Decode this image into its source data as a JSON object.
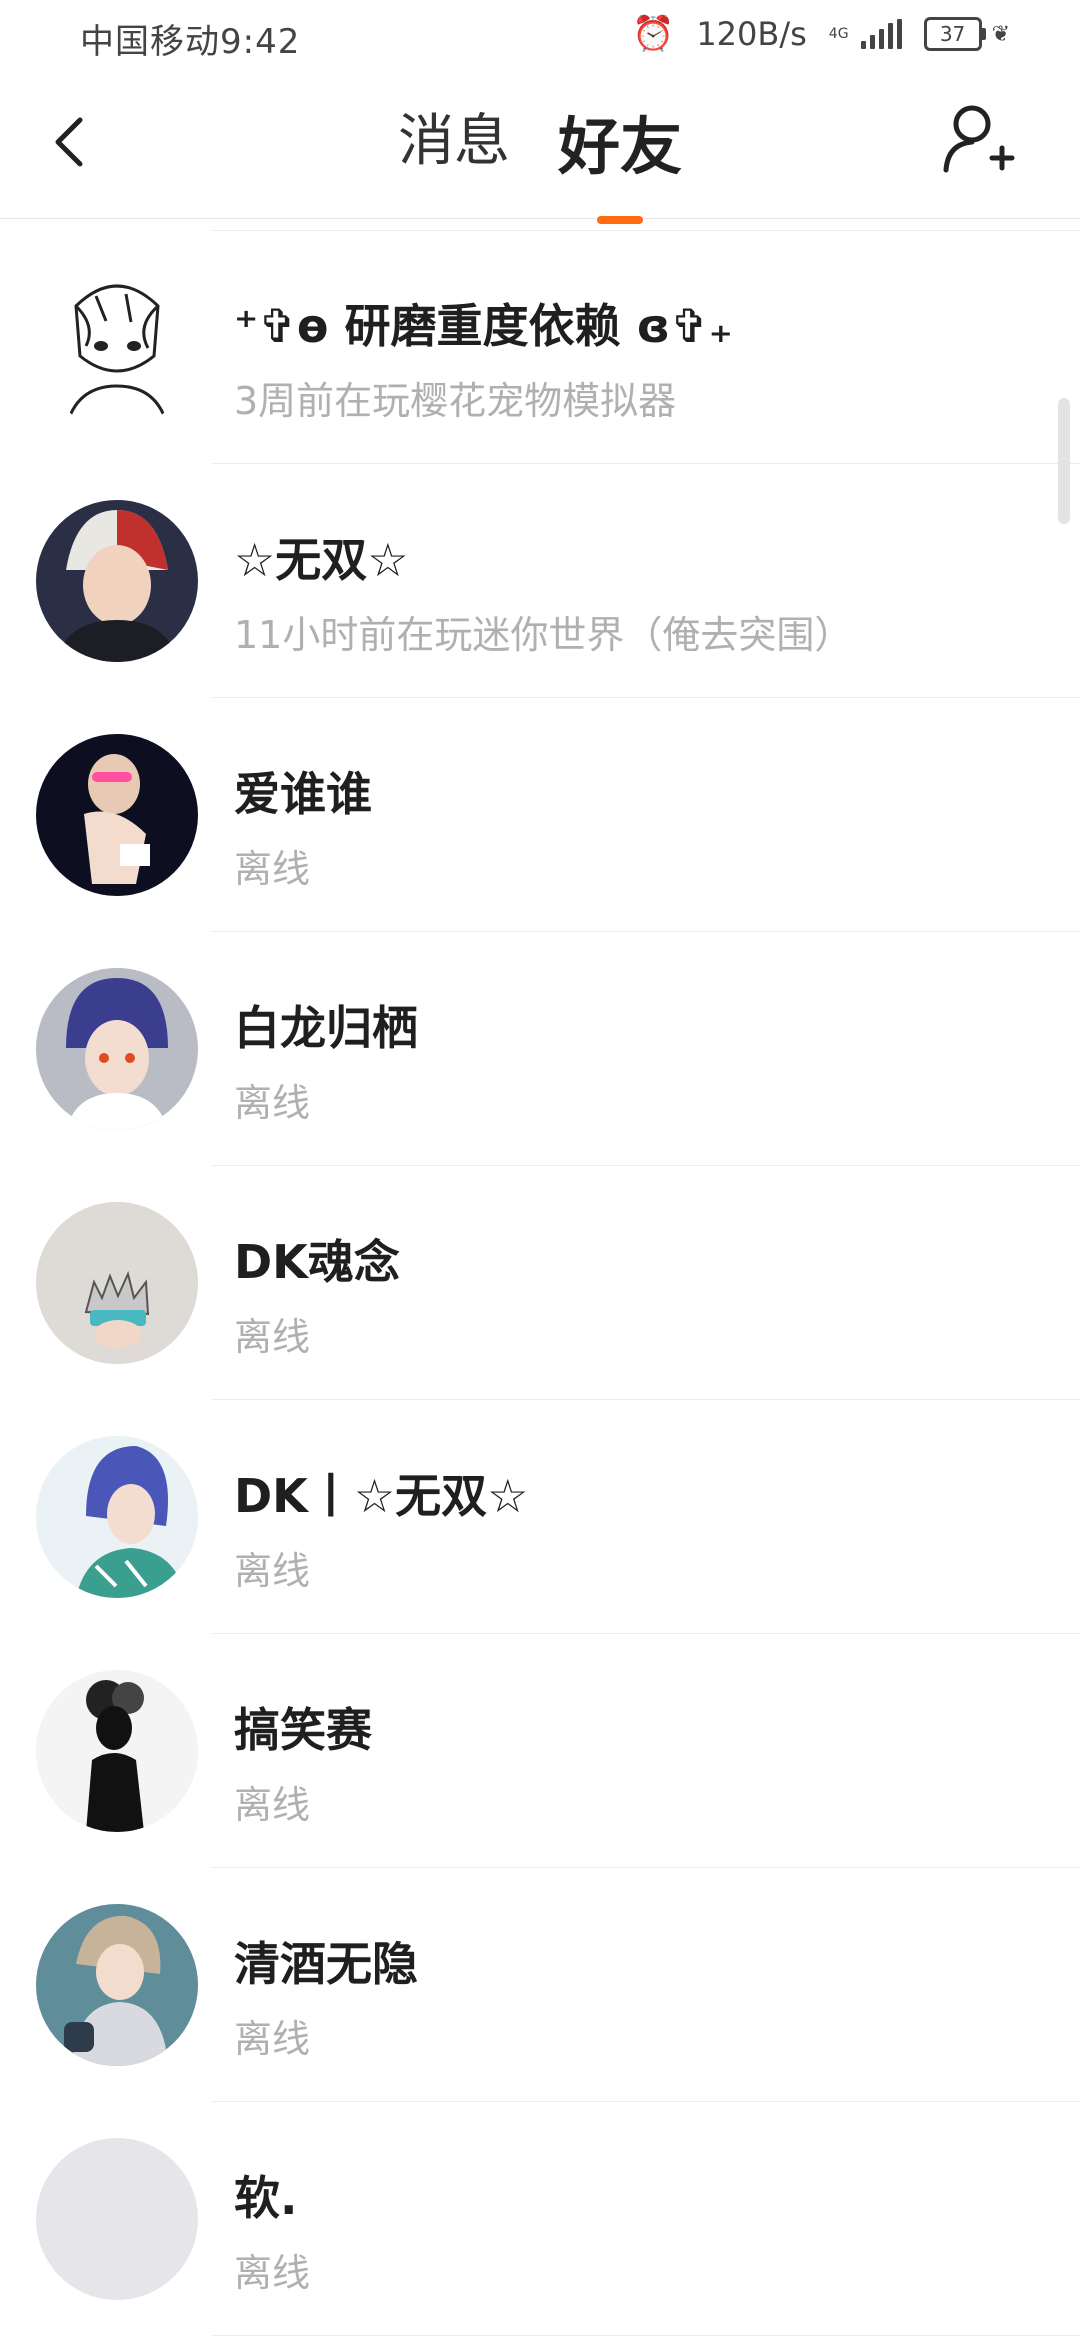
{
  "status_bar": {
    "carrier": "中国移动",
    "time": "9:42",
    "net_speed": "120B/s",
    "net_type": "4G",
    "battery": "37",
    "icons": [
      "alarm-icon",
      "signal-icon",
      "battery-icon",
      "leaf-icon"
    ]
  },
  "header": {
    "tabs": [
      {
        "label": "消息",
        "active": false
      },
      {
        "label": "好友",
        "active": true
      }
    ],
    "accent_color": "#ff6a13",
    "back_icon": "chevron-left-icon",
    "add_icon": "add-user-icon"
  },
  "friends": [
    {
      "name": "⁺✞ɵ 研磨重度依赖 ɞ✞₊",
      "status": "3周前在玩樱花宠物模拟器"
    },
    {
      "name": "☆无双☆",
      "status": "11小时前在玩迷你世界（俺去突围）"
    },
    {
      "name": "爱谁谁",
      "status": "离线"
    },
    {
      "name": "白龙归栖",
      "status": "离线"
    },
    {
      "name": "DK魂念",
      "status": "离线"
    },
    {
      "name": "DK丨☆无双☆",
      "status": "离线"
    },
    {
      "name": "搞笑赛",
      "status": "离线"
    },
    {
      "name": "清酒无隐",
      "status": "离线"
    },
    {
      "name": "软.",
      "status": "离线"
    }
  ]
}
